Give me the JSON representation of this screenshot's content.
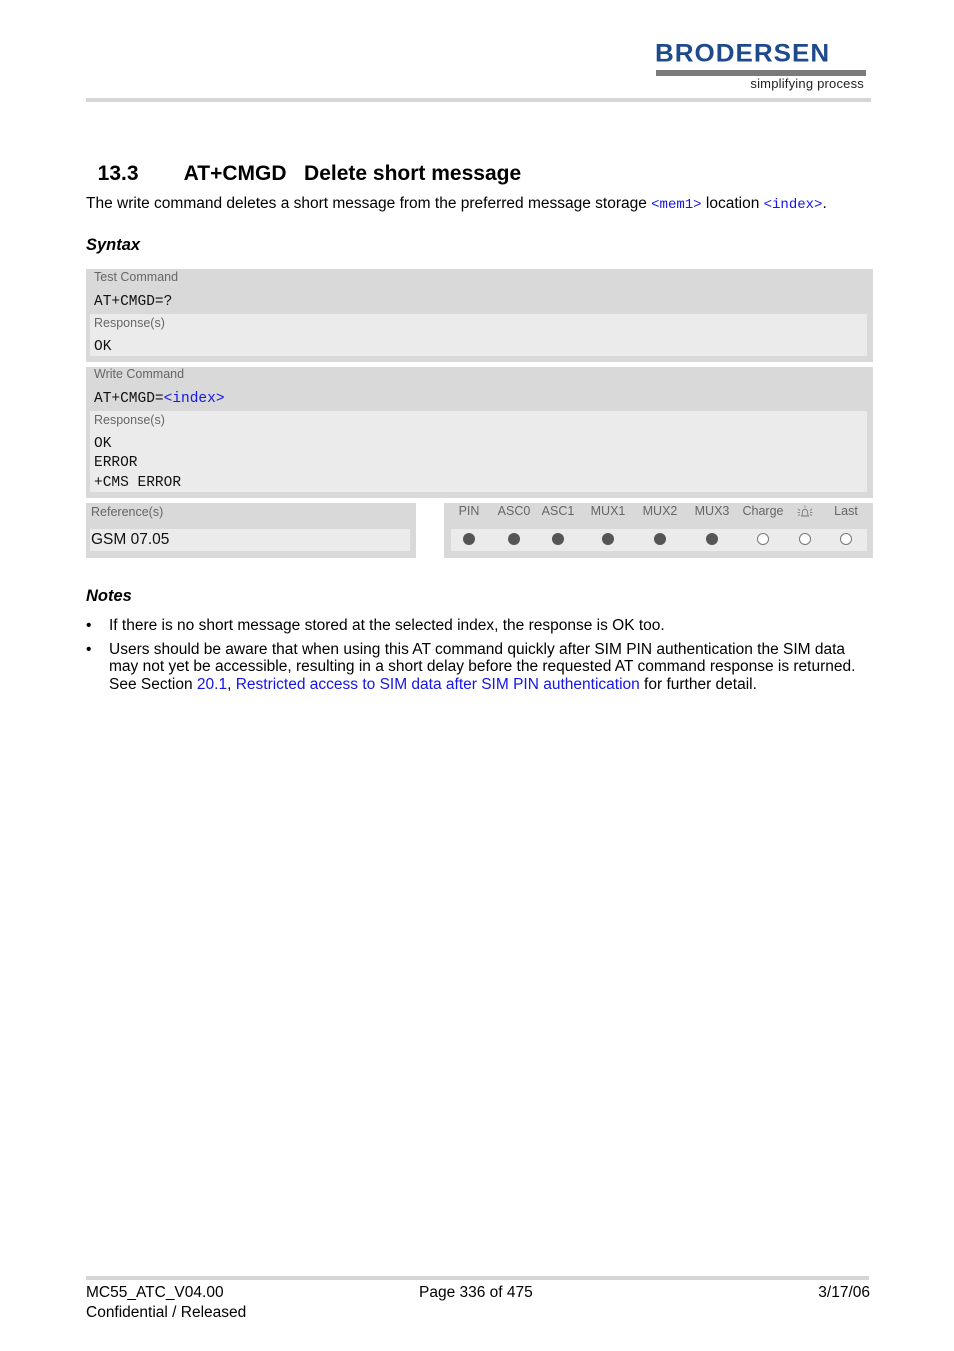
{
  "header": {
    "logo_text": "BRODERSEN",
    "logo_tagline": "simplifying process"
  },
  "section": {
    "number": "13.3",
    "command": "AT+CMGD",
    "title": "Delete short message"
  },
  "intro": {
    "text_before": "The write command deletes a short message from the preferred message storage ",
    "param1": "<mem1>",
    "text_middle": " location ",
    "param2": "<index>",
    "text_after": "."
  },
  "syntax": {
    "heading": "Syntax",
    "test_command": {
      "label": "Test Command",
      "command": "AT+CMGD=?",
      "response_label": "Response(s)",
      "responses": [
        "OK"
      ]
    },
    "write_command": {
      "label": "Write Command",
      "command_prefix": "AT+CMGD=",
      "command_param": "<index>",
      "response_label": "Response(s)",
      "responses": [
        "OK",
        "ERROR",
        "+CMS ERROR"
      ]
    },
    "reference": {
      "label": "Reference(s)",
      "value": "GSM 07.05"
    },
    "availability": {
      "columns": [
        {
          "label": "PIN",
          "icon": null,
          "available": true
        },
        {
          "label": "ASC0",
          "icon": null,
          "available": true
        },
        {
          "label": "ASC1",
          "icon": null,
          "available": true
        },
        {
          "label": "MUX1",
          "icon": null,
          "available": true
        },
        {
          "label": "MUX2",
          "icon": null,
          "available": true
        },
        {
          "label": "MUX3",
          "icon": null,
          "available": true
        },
        {
          "label": "Charge",
          "icon": null,
          "available": false
        },
        {
          "label": "",
          "icon": "alarm-bell-icon",
          "available": false
        },
        {
          "label": "Last",
          "icon": null,
          "available": false
        }
      ]
    }
  },
  "notes": {
    "heading": "Notes",
    "items": [
      {
        "text": "If there is no short message stored at the selected index, the response is OK too."
      },
      {
        "text_line1": "Users should be aware that when using this AT command quickly after SIM PIN authentication the SIM data",
        "text_line2": "may not yet be accessible, resulting in a short delay before the requested AT command response is returned.",
        "see_prefix": "See Section ",
        "section_link": "20.1",
        "separator": ", ",
        "title_link": "Restricted access to SIM data after SIM PIN authentication",
        "suffix": " for further detail."
      }
    ],
    "bullet": "•"
  },
  "footer": {
    "doc_id": "MC55_ATC_V04.00",
    "status": "Confidential / Released",
    "page": "Page 336 of 475",
    "date": "3/17/06"
  }
}
